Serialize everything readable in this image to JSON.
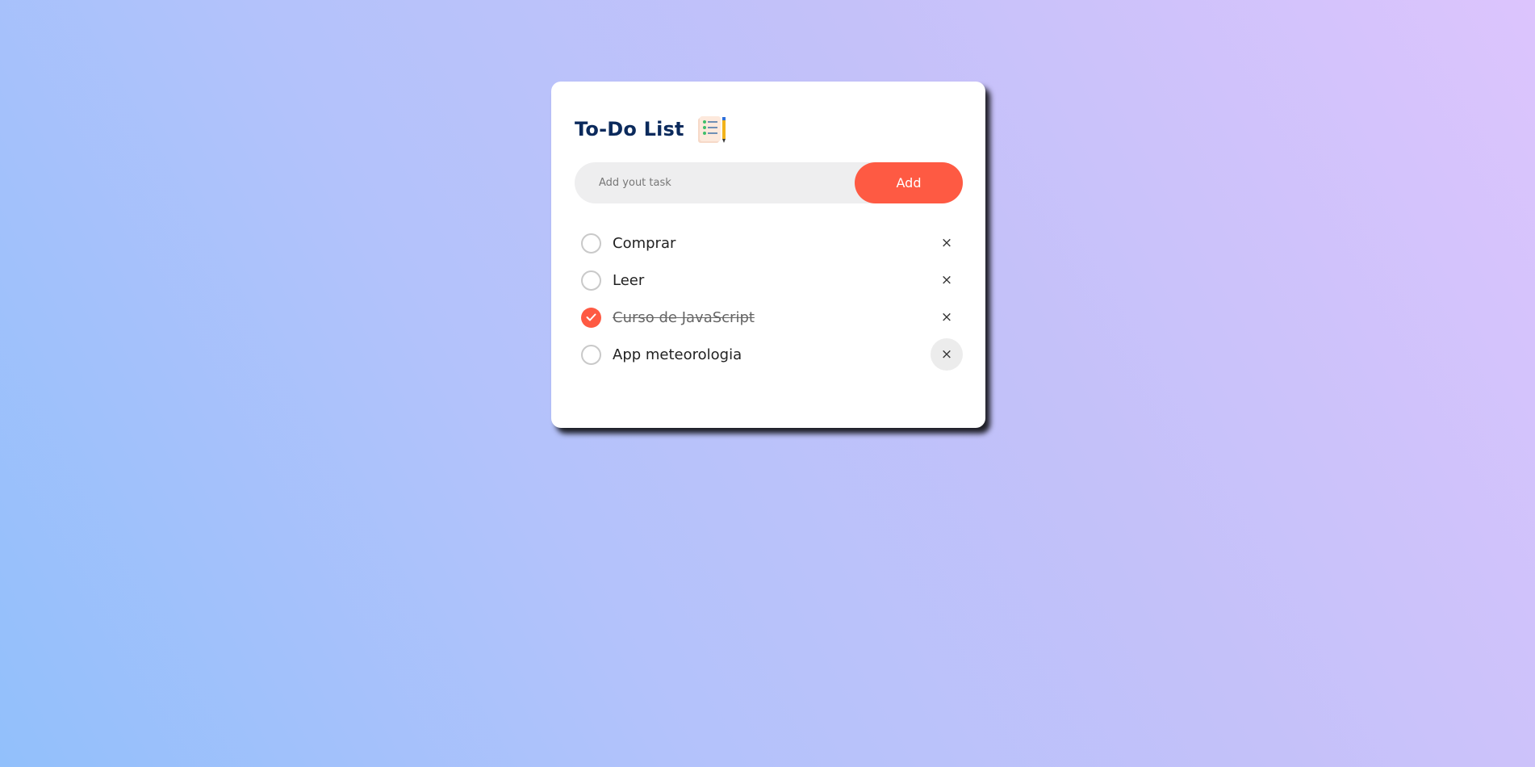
{
  "app": {
    "title": "To-Do List",
    "title_icon": "checklist-notepad-pencil-icon"
  },
  "input": {
    "placeholder": "Add yout task",
    "value": ""
  },
  "add_button": {
    "label": "Add"
  },
  "tasks": [
    {
      "label": "Comprar",
      "completed": false,
      "delete_icon": "×"
    },
    {
      "label": "Leer",
      "completed": false,
      "delete_icon": "×"
    },
    {
      "label": "Curso de JavaScript",
      "completed": true,
      "delete_icon": "×"
    },
    {
      "label": "App meteorologia",
      "completed": false,
      "delete_icon": "×"
    }
  ],
  "colors": {
    "accent": "#fe5a43",
    "title": "#0b2a5c",
    "input_bg": "#eeeeef"
  }
}
